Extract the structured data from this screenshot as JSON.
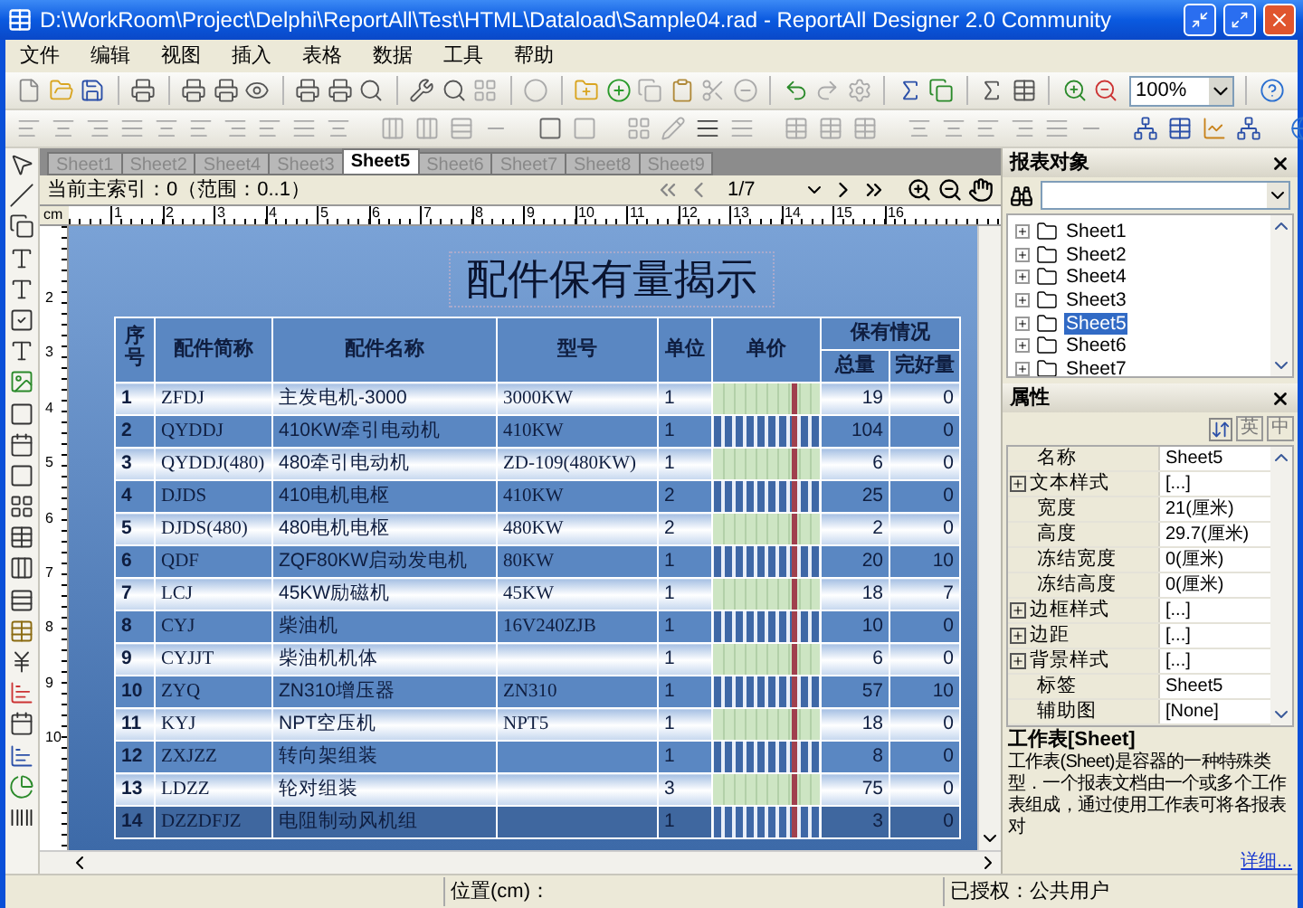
{
  "window": {
    "title": "D:\\WorkRoom\\Project\\Delphi\\ReportAll\\Test\\HTML\\Dataload\\Sample04.rad - ReportAll Designer 2.0 Community"
  },
  "menu": [
    "文件",
    "编辑",
    "视图",
    "插入",
    "表格",
    "数据",
    "工具",
    "帮助"
  ],
  "toolbar": {
    "zoom": "100%"
  },
  "sheet_tabs": [
    {
      "label": "Sheet1",
      "selected": false
    },
    {
      "label": "Sheet2",
      "selected": false
    },
    {
      "label": "Sheet4",
      "selected": false
    },
    {
      "label": "Sheet3",
      "selected": false
    },
    {
      "label": "Sheet5",
      "selected": true
    },
    {
      "label": "Sheet6",
      "selected": false
    },
    {
      "label": "Sheet7",
      "selected": false
    },
    {
      "label": "Sheet8",
      "selected": false
    },
    {
      "label": "Sheet9",
      "selected": false
    }
  ],
  "navigator": {
    "index_label": "当前主索引：0（范围：0..1）",
    "page": "1/7"
  },
  "ruler": {
    "unit": "cm",
    "horizontal": [
      "1",
      "2",
      "3",
      "4",
      "5",
      "6",
      "7",
      "8",
      "9",
      "10",
      "11",
      "12",
      "13",
      "14",
      "15",
      "16"
    ],
    "vertical": [
      "2",
      "3",
      "4",
      "5",
      "6",
      "7",
      "8",
      "9",
      "10"
    ]
  },
  "report": {
    "title": "配件保有量揭示",
    "columns": [
      "序号",
      "配件简称",
      "配件名称",
      "型号",
      "单位",
      "单价"
    ],
    "group_header": "保有情况",
    "subcolumns": [
      "总量",
      "完好量"
    ],
    "rows": [
      {
        "no": "1",
        "code": "ZFDJ",
        "name": "主发电机-3000",
        "model": "3000KW",
        "unit": "1",
        "total": "19",
        "intact": "0"
      },
      {
        "no": "2",
        "code": "QYDDJ",
        "name": "410KW牵引电动机",
        "model": "410KW",
        "unit": "1",
        "total": "104",
        "intact": "0"
      },
      {
        "no": "3",
        "code": "QYDDJ(480)",
        "name": "480牵引电动机",
        "model": "ZD-109(480KW)",
        "unit": "1",
        "total": "6",
        "intact": "0"
      },
      {
        "no": "4",
        "code": "DJDS",
        "name": "410电机电枢",
        "model": "410KW",
        "unit": "2",
        "total": "25",
        "intact": "0"
      },
      {
        "no": "5",
        "code": "DJDS(480)",
        "name": "480电机电枢",
        "model": "480KW",
        "unit": "2",
        "total": "2",
        "intact": "0"
      },
      {
        "no": "6",
        "code": "QDF",
        "name": "ZQF80KW启动发电机",
        "model": "80KW",
        "unit": "1",
        "total": "20",
        "intact": "10"
      },
      {
        "no": "7",
        "code": "LCJ",
        "name": "45KW励磁机",
        "model": "45KW",
        "unit": "1",
        "total": "18",
        "intact": "7"
      },
      {
        "no": "8",
        "code": "CYJ",
        "name": "柴油机",
        "model": "16V240ZJB",
        "unit": "1",
        "total": "10",
        "intact": "0"
      },
      {
        "no": "9",
        "code": "CYJJT",
        "name": "柴油机机体",
        "unit": "1",
        "total": "6",
        "intact": "0"
      },
      {
        "no": "10",
        "code": "ZYQ",
        "name": "ZN310增压器",
        "model": "ZN310",
        "unit": "1",
        "total": "57",
        "intact": "10"
      },
      {
        "no": "11",
        "code": "KYJ",
        "name": "NPT空压机",
        "model": "NPT5",
        "unit": "1",
        "total": "18",
        "intact": "0"
      },
      {
        "no": "12",
        "code": "ZXJZZ",
        "name": "转向架组装",
        "unit": "1",
        "total": "8",
        "intact": "0"
      },
      {
        "no": "13",
        "code": "LDZZ",
        "name": "轮对组装",
        "unit": "3",
        "total": "75",
        "intact": "0"
      },
      {
        "no": "14",
        "code": "DZZDFJZ",
        "name": "电阻制动风机组",
        "unit": "1",
        "total": "3",
        "intact": "0"
      }
    ]
  },
  "objects_panel": {
    "title": "报表对象",
    "items": [
      {
        "label": "Sheet1",
        "selected": false
      },
      {
        "label": "Sheet2",
        "selected": false
      },
      {
        "label": "Sheet4",
        "selected": false
      },
      {
        "label": "Sheet3",
        "selected": false
      },
      {
        "label": "Sheet5",
        "selected": true
      },
      {
        "label": "Sheet6",
        "selected": false
      },
      {
        "label": "Sheet7",
        "selected": false
      }
    ]
  },
  "properties_panel": {
    "title": "属性",
    "sort_buttons": [
      "英",
      "中"
    ],
    "rows": [
      {
        "name": "名称",
        "value": "Sheet5",
        "expandable": false
      },
      {
        "name": "文本样式",
        "value": "[...]",
        "expandable": true
      },
      {
        "name": "宽度",
        "value": "21(厘米)",
        "expandable": false
      },
      {
        "name": "高度",
        "value": "29.7(厘米)",
        "expandable": false
      },
      {
        "name": "冻结宽度",
        "value": "0(厘米)",
        "expandable": false
      },
      {
        "name": "冻结高度",
        "value": "0(厘米)",
        "expandable": false
      },
      {
        "name": "边框样式",
        "value": "[...]",
        "expandable": true
      },
      {
        "name": "边距",
        "value": "[...]",
        "expandable": true
      },
      {
        "name": "背景样式",
        "value": "[...]",
        "expandable": true
      },
      {
        "name": "标签",
        "value": "Sheet5",
        "expandable": false
      },
      {
        "name": "辅助图",
        "value": "[None]",
        "expandable": false
      }
    ],
    "description": {
      "title": "工作表[Sheet]",
      "text": "工作表(Sheet)是容器的一种特殊类型．一个报表文档由一个或多个工作表组成，通过使用工作表可将各报表对",
      "link": "详细..."
    }
  },
  "status_bar": {
    "position": "位置(cm)：",
    "license": "已授权：公共用户"
  }
}
